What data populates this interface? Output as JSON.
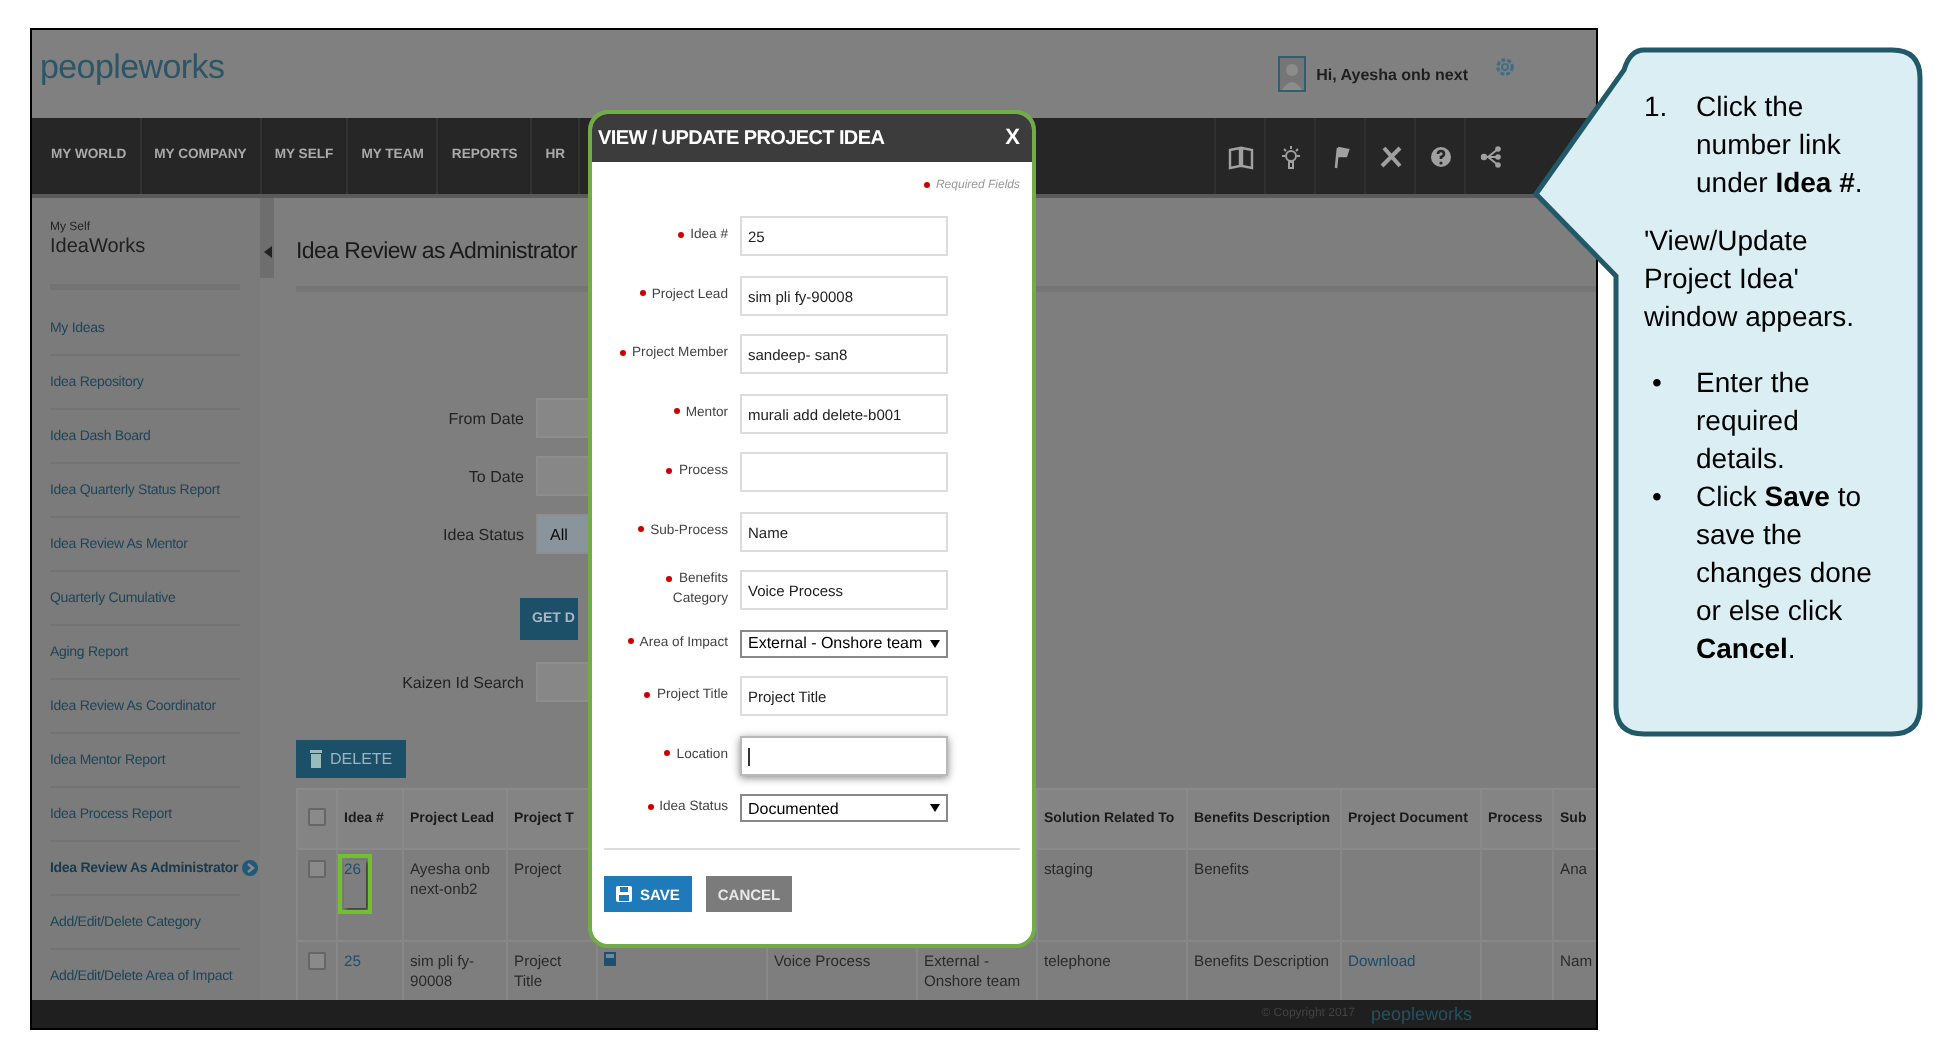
{
  "header": {
    "logo": "peopleworks",
    "greeting": "Hi, Ayesha onb next"
  },
  "nav": {
    "items": [
      "MY WORLD",
      "MY COMPANY",
      "MY SELF",
      "MY TEAM",
      "REPORTS",
      "HR"
    ]
  },
  "sidebar": {
    "section": "My Self",
    "title": "IdeaWorks",
    "items": [
      {
        "label": "My Ideas",
        "selected": false
      },
      {
        "label": "Idea Repository",
        "selected": false
      },
      {
        "label": "Idea Dash Board",
        "selected": false
      },
      {
        "label": "Idea Quarterly Status Report",
        "selected": false
      },
      {
        "label": "Idea Review As Mentor",
        "selected": false
      },
      {
        "label": "Quarterly Cumulative",
        "selected": false
      },
      {
        "label": "Aging Report",
        "selected": false
      },
      {
        "label": "Idea Review As Coordinator",
        "selected": false
      },
      {
        "label": "Idea Mentor Report",
        "selected": false
      },
      {
        "label": "Idea Process Report",
        "selected": false
      },
      {
        "label": "Idea Review As Administrator",
        "selected": true
      },
      {
        "label": "Add/Edit/Delete Category",
        "selected": false
      },
      {
        "label": "Add/Edit/Delete Area of Impact",
        "selected": false
      }
    ]
  },
  "page_title": "Idea Review as Administrator",
  "filters": {
    "from_date": {
      "label": "From Date"
    },
    "to_date": {
      "label": "To Date"
    },
    "idea_status": {
      "label": "Idea Status",
      "value": "All"
    },
    "get_button": "GET D",
    "kaizen": {
      "label": "Kaizen Id Search"
    }
  },
  "delete_button": "DELETE",
  "table": {
    "header_checked": false,
    "columns": {
      "idea": "Idea #",
      "project_lead": "Project Lead",
      "project_t": "Project T",
      "solution_related_to": "Solution Related To",
      "benefits_description": "Benefits Description",
      "project_document": "Project Document",
      "process": "Process",
      "sub": "Sub"
    },
    "rows": [
      {
        "checked": false,
        "highlighted": true,
        "idea": "26",
        "project_lead": "Ayesha onb next-onb2",
        "project_t": "Project",
        "solution_related_to": "staging",
        "benefits_description": "Benefits",
        "sub": "Ana"
      },
      {
        "checked": false,
        "highlighted": false,
        "has_icon": true,
        "idea": "25",
        "project_lead": "sim pli fy-90008",
        "project_t": "Project Title",
        "column_6": "Voice Process",
        "column_7": "External - Onshore team",
        "solution_related_to": "telephone",
        "benefits_description": "Benefits Description",
        "project_document": "Download",
        "sub": "Nam"
      }
    ]
  },
  "footer": {
    "copyright": "© Copyright 2017",
    "logo": "peopleworks"
  },
  "modal": {
    "title": "VIEW / UPDATE PROJECT IDEA",
    "close": "X",
    "highlighted": true,
    "required_note": "Required Fields",
    "fields": [
      {
        "kind": "text",
        "label": "Idea #",
        "value": "25",
        "required": true,
        "focused": false
      },
      {
        "kind": "text",
        "label": "Project Lead",
        "value": "sim pli fy-90008",
        "required": true,
        "focused": false
      },
      {
        "kind": "text",
        "label": "Project Member",
        "value": "sandeep- san8",
        "required": true,
        "focused": false
      },
      {
        "kind": "text",
        "label": "Mentor",
        "value": "murali add delete-b001",
        "required": true,
        "focused": false
      },
      {
        "kind": "text",
        "label": "Process",
        "required": true,
        "focused": false
      },
      {
        "kind": "text",
        "label": "Sub-Process",
        "value": "Name",
        "required": true,
        "focused": false
      },
      {
        "kind": "text",
        "label": "Benefits Category",
        "value": "Voice Process",
        "required": true,
        "focused": false
      },
      {
        "kind": "select",
        "label": "Area of Impact",
        "value": "External - Onshore team",
        "required": true
      },
      {
        "kind": "text",
        "label": "Project Title",
        "value": "Project Title",
        "required": true,
        "focused": false
      },
      {
        "kind": "text",
        "label": "Location",
        "required": true,
        "focused": true
      },
      {
        "kind": "select",
        "label": "Idea Status",
        "value": "Documented",
        "required": true
      }
    ],
    "buttons": [
      {
        "kind": "primary",
        "label": "SAVE"
      },
      {
        "kind": "secondary",
        "label": "CANCEL"
      }
    ]
  },
  "callout": {
    "items": [
      {
        "kind": "numbered",
        "marker": "1.",
        "text": "Click the number link under **Idea #**."
      },
      {
        "kind": "paragraph",
        "text": "'View/Update Project Idea' window appears."
      },
      {
        "kind": "bullet",
        "marker": "•",
        "text": "Enter the required details."
      },
      {
        "kind": "bullet",
        "marker": "•",
        "text": "Click **Save** to save the changes done or else click **Cancel**."
      }
    ]
  }
}
